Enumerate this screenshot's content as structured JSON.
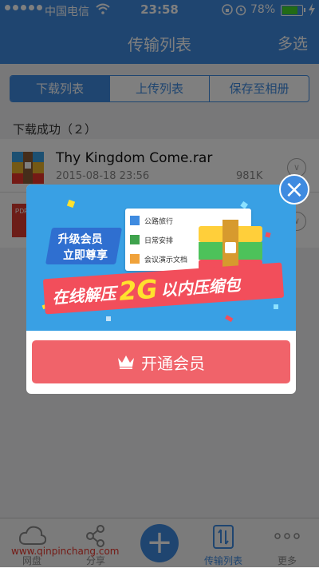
{
  "status_bar": {
    "carrier": "中国电信",
    "time": "23:58",
    "battery_percent": "78%",
    "battery_level": 0.78
  },
  "nav": {
    "title": "传输列表",
    "right_action": "多选"
  },
  "tabs": [
    {
      "label": "下载列表",
      "active": true
    },
    {
      "label": "上传列表",
      "active": false
    },
    {
      "label": "保存至相册",
      "active": false
    }
  ],
  "section_header": "下载成功（２）",
  "files": [
    {
      "name": "Thy Kingdom Come.rar",
      "date": "2015-08-18 23:56",
      "size": "981K",
      "icon": "rar-archive-icon"
    },
    {
      "name": "",
      "date": "",
      "size": "",
      "icon": "pdf-file-icon"
    }
  ],
  "popup": {
    "banner": {
      "badge_line1": "升级会员",
      "badge_line2": "立即尊享",
      "headline_prefix": "在线解压",
      "headline_highlight": "2G",
      "headline_suffix": "以内压缩包",
      "file_list": [
        "公路旅行",
        "日常安排",
        "会议演示文档"
      ]
    },
    "button_label": "开通会员"
  },
  "tabbar": {
    "items": [
      {
        "label": "网盘",
        "icon": "cloud-icon"
      },
      {
        "label": "分享",
        "icon": "share-icon"
      },
      {
        "label": "",
        "icon": "plus-icon"
      },
      {
        "label": "传输列表",
        "icon": "transfer-icon"
      },
      {
        "label": "更多",
        "icon": "more-icon"
      }
    ]
  },
  "watermark": "www.qinpinchang.com",
  "colors": {
    "primary": "#3f8be0",
    "member_button": "#f0636a",
    "banner_bg": "#39a0e4",
    "ribbon": "#f24e5b",
    "highlight": "#ffe12e"
  }
}
